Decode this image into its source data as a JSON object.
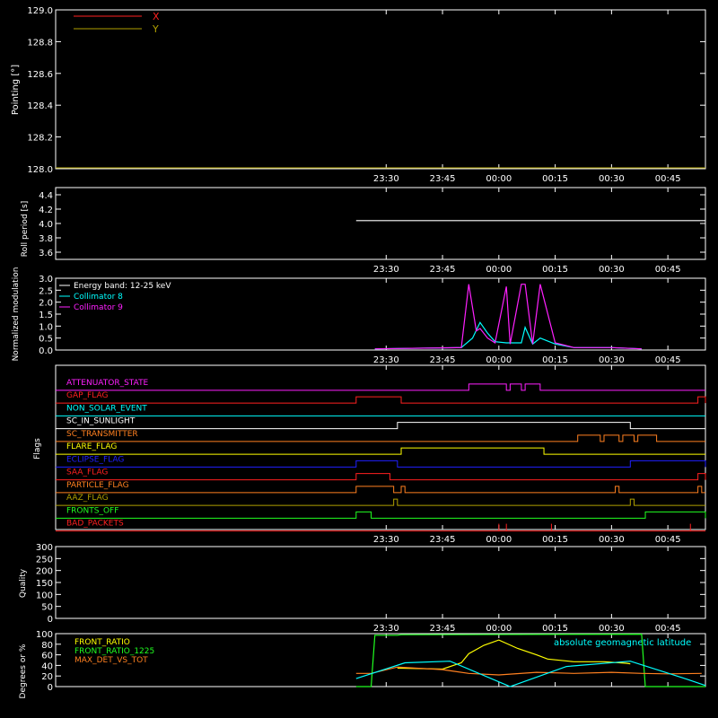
{
  "time_ticks": [
    "23:30",
    "23:45",
    "00:00",
    "00:15",
    "00:30",
    "00:45"
  ],
  "colors": {
    "background": "#000000",
    "axes": "#ffffff",
    "x": "#ff2020",
    "y": "#b0a000",
    "cyan": "#00ffff",
    "magenta": "#ff20ff",
    "yellow": "#ffff00",
    "green": "#20ff20",
    "orange": "#ff8020"
  },
  "chart_data": [
    {
      "id": "pointing",
      "type": "line",
      "ylabel": "Pointing [°]",
      "ylim": [
        128.0,
        129.0
      ],
      "yticks": [
        "128.0",
        "128.2",
        "128.4",
        "128.6",
        "128.8",
        "129.0"
      ],
      "legend_position": "top-left",
      "series": [
        {
          "name": "X",
          "color": "#ff2020",
          "values": []
        },
        {
          "name": "Y",
          "color": "#b0a000",
          "values": []
        }
      ]
    },
    {
      "id": "roll",
      "type": "line",
      "ylabel": "Roll period [s]",
      "ylim": [
        3.5,
        4.5
      ],
      "yticks": [
        "3.6",
        "3.8",
        "4.0",
        "4.2",
        "4.4"
      ],
      "series": [
        {
          "color": "#ffffff",
          "x": [
            "23:22",
            "00:55"
          ],
          "values": [
            4.04,
            4.04
          ]
        }
      ]
    },
    {
      "id": "modulation",
      "type": "line",
      "ylabel": "Normalized modulation",
      "ylim": [
        0.0,
        3.0
      ],
      "yticks": [
        "0.0",
        "0.5",
        "1.0",
        "1.5",
        "2.0",
        "2.5",
        "3.0"
      ],
      "legend_position": "top-left",
      "series": [
        {
          "name": "Energy band: 12-25 keV",
          "color": "#ffffff"
        },
        {
          "name": "Collimator 8",
          "color": "#00ffff",
          "x": [
            "23:27",
            "23:50",
            "23:53",
            "23:55",
            "23:57",
            "23:59",
            "00:02",
            "00:06",
            "00:07",
            "00:09",
            "00:11",
            "00:15",
            "00:20",
            "00:30",
            "00:38"
          ],
          "values": [
            0.05,
            0.1,
            0.5,
            1.15,
            0.7,
            0.35,
            0.3,
            0.3,
            0.95,
            0.25,
            0.5,
            0.25,
            0.1,
            0.1,
            0.05
          ]
        },
        {
          "name": "Collimator 9",
          "color": "#ff20ff",
          "x": [
            "23:27",
            "23:50",
            "23:52",
            "23:54",
            "23:55",
            "23:57",
            "23:59",
            "00:02",
            "00:03",
            "00:06",
            "00:07",
            "00:09",
            "00:11",
            "00:15",
            "00:20",
            "00:30",
            "00:38"
          ],
          "values": [
            0.05,
            0.1,
            2.75,
            0.8,
            0.9,
            0.5,
            0.3,
            2.65,
            0.25,
            2.75,
            2.75,
            0.25,
            2.75,
            0.3,
            0.1,
            0.1,
            0.05
          ]
        }
      ]
    },
    {
      "id": "flags",
      "type": "line",
      "ylabel": "Flags",
      "flags": [
        {
          "label": "ATTENUATOR_STATE",
          "color": "#ff20ff",
          "on": [
            [
              "23:52",
              "00:02"
            ],
            [
              "00:03",
              "00:06"
            ],
            [
              "00:07",
              "00:11"
            ]
          ]
        },
        {
          "label": "GAP_FLAG",
          "color": "#ff2020",
          "on": [
            [
              "23:22",
              "23:34"
            ],
            [
              "00:53",
              "00:55"
            ]
          ]
        },
        {
          "label": "NON_SOLAR_EVENT",
          "color": "#00ffff",
          "on": []
        },
        {
          "label": "SC_IN_SUNLIGHT",
          "color": "#ffffff",
          "on": [
            [
              "23:33",
              "00:35"
            ]
          ]
        },
        {
          "label": "SC_TRANSMITTER",
          "color": "#ff8020",
          "on": [
            [
              "00:21",
              "00:27"
            ],
            [
              "00:28",
              "00:32"
            ],
            [
              "00:33",
              "00:36"
            ],
            [
              "00:37",
              "00:42"
            ]
          ]
        },
        {
          "label": "FLARE_FLAG",
          "color": "#ffff00",
          "on": [
            [
              "23:34",
              "00:12"
            ]
          ]
        },
        {
          "label": "ECLIPSE_FLAG",
          "color": "#2020ff",
          "on": [
            [
              "23:22",
              "23:33"
            ],
            [
              "00:35",
              "00:55"
            ]
          ]
        },
        {
          "label": "SAA_FLAG",
          "color": "#ff2020",
          "on": [
            [
              "23:22",
              "23:31"
            ],
            [
              "00:53",
              "00:55"
            ]
          ]
        },
        {
          "label": "PARTICLE_FLAG",
          "color": "#ff8020",
          "on": [
            [
              "23:22",
              "23:32"
            ],
            [
              "23:34",
              "23:35"
            ],
            [
              "00:31",
              "00:32"
            ],
            [
              "00:53",
              "00:54"
            ]
          ]
        },
        {
          "label": "AAZ_FLAG",
          "color": "#b0a000",
          "on": [
            [
              "23:32",
              "23:33"
            ],
            [
              "00:35",
              "00:36"
            ]
          ]
        },
        {
          "label": "FRONTS_OFF",
          "color": "#20ff20",
          "on": [
            [
              "23:22",
              "23:26"
            ],
            [
              "00:39",
              "00:55"
            ]
          ]
        },
        {
          "label": "BAD_PACKETS",
          "color": "#ff2020",
          "spikes": [
            "00:00",
            "00:02",
            "00:14",
            "00:51"
          ]
        }
      ]
    },
    {
      "id": "quality",
      "type": "line",
      "ylabel": "Quality",
      "ylim": [
        0,
        300
      ],
      "yticks": [
        "0",
        "50",
        "100",
        "150",
        "200",
        "250",
        "300"
      ],
      "series": []
    },
    {
      "id": "fronts",
      "type": "line",
      "ylabel": "Degrees or %",
      "ylim": [
        0,
        100
      ],
      "yticks": [
        "0",
        "20",
        "40",
        "60",
        "80",
        "100"
      ],
      "legend_position": "top-left",
      "annotation": "absolute geomagnetic latitude",
      "series": [
        {
          "name": "FRONT_RATIO",
          "color": "#ffff00",
          "x": [
            "23:33",
            "23:45",
            "23:50",
            "23:52",
            "23:56",
            "00:00",
            "00:05",
            "00:10",
            "00:13",
            "00:20",
            "00:28",
            "00:34",
            "00:35"
          ],
          "values": [
            35,
            33,
            45,
            62,
            78,
            88,
            72,
            60,
            52,
            47,
            47,
            44,
            43
          ]
        },
        {
          "name": "FRONT_RATIO_1225",
          "color": "#20ff20",
          "x": [
            "23:22",
            "23:26",
            "23:27",
            "23:33",
            "23:34",
            "00:38",
            "00:39",
            "00:55"
          ],
          "values": [
            0,
            0,
            97,
            97,
            98,
            99,
            0,
            0
          ]
        },
        {
          "name": "MAX_DET_VS_TOT",
          "color": "#ff8020",
          "x": [
            "23:22",
            "23:26",
            "23:33",
            "23:45",
            "23:52",
            "00:00",
            "00:10",
            "00:20",
            "00:30",
            "00:38",
            "00:45",
            "00:54"
          ],
          "values": [
            25,
            25,
            37,
            32,
            25,
            22,
            27,
            25,
            27,
            25,
            24,
            25
          ]
        },
        {
          "name": "absolute geomagnetic latitude",
          "color": "#00ffff",
          "x": [
            "23:22",
            "23:35",
            "23:47",
            "00:03",
            "00:18",
            "00:35",
            "00:50",
            "00:55"
          ],
          "values": [
            15,
            45,
            48,
            0,
            38,
            48,
            14,
            2
          ]
        }
      ]
    }
  ]
}
